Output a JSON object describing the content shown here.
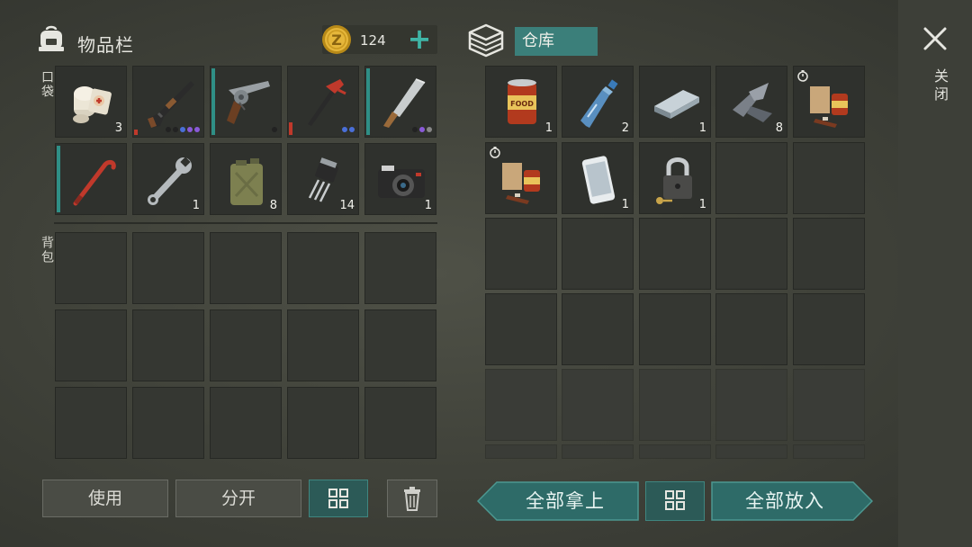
{
  "inventory": {
    "title": "物品栏",
    "coins": "124",
    "add_symbol": "+",
    "pocket_label": "口袋",
    "backpack_label": "背包",
    "pocket_slots": [
      {
        "icon": "bandage-icon",
        "count": "3"
      },
      {
        "icon": "shotgun-icon",
        "count": ""
      },
      {
        "icon": "revolver-icon",
        "count": ""
      },
      {
        "icon": "hammer-icon",
        "count": ""
      },
      {
        "icon": "machete-icon",
        "count": ""
      },
      {
        "icon": "crowbar-icon",
        "count": ""
      },
      {
        "icon": "wrench-icon",
        "count": "1"
      },
      {
        "icon": "jerrycan-icon",
        "count": "8"
      },
      {
        "icon": "transistor-icon",
        "count": "14"
      },
      {
        "icon": "camera-icon",
        "count": "1"
      }
    ]
  },
  "warehouse": {
    "title": "仓库",
    "slots": [
      {
        "icon": "canned-food-icon",
        "count": "1"
      },
      {
        "icon": "water-bottle-icon",
        "count": "2"
      },
      {
        "icon": "metal-ingot-icon",
        "count": "1"
      },
      {
        "icon": "scrap-metal-icon",
        "count": "8"
      },
      {
        "icon": "food-bundle-icon",
        "count": ""
      },
      {
        "icon": "food-bundle-icon",
        "count": ""
      },
      {
        "icon": "smartphone-icon",
        "count": "1"
      },
      {
        "icon": "padlock-icon",
        "count": "1"
      }
    ]
  },
  "close_label": "关闭",
  "buttons": {
    "use": "使用",
    "split": "分开",
    "take_all": "全部拿上",
    "put_all": "全部放入"
  },
  "colors": {
    "accent_teal": "#2e6b68",
    "coin_gold": "#d8a928",
    "durability_teal": "#2f8f86",
    "durability_red": "#c0392b"
  }
}
